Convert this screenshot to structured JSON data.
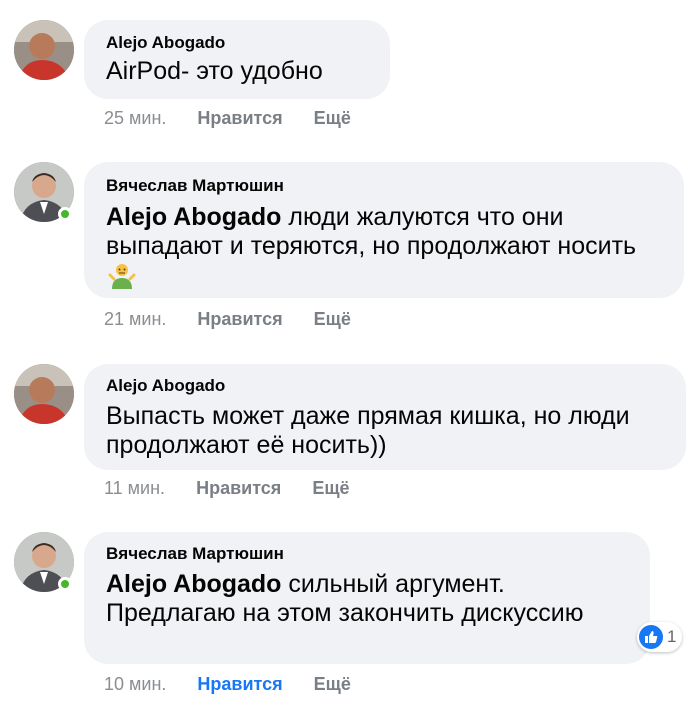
{
  "comments": [
    {
      "author": "Alejo Abogado",
      "mention": "",
      "text": "AirPod- это удобно",
      "time": "25 мин.",
      "like_label": "Нравится",
      "more_label": "Ещё"
    },
    {
      "author": "Вячеслав Мартюшин",
      "mention": "Alejo Abogado",
      "text": "люди жалуются что они выпадают и теряются, но продолжают носить",
      "emoji": "person-shrugging-emoji",
      "time": "21 мин.",
      "like_label": "Нравится",
      "more_label": "Ещё"
    },
    {
      "author": "Alejo Abogado",
      "mention": "",
      "text": "Выпасть может даже прямая кишка, но люди продолжают её носить))",
      "time": "11 мин.",
      "like_label": "Нравится",
      "more_label": "Ещё"
    },
    {
      "author": "Вячеслав Мартюшин",
      "mention": "Alejo Abogado",
      "text": "сильный аргумент. Предлагаю на этом закончить дискуссию",
      "time": "10 мин.",
      "like_label": "Нравится",
      "more_label": "Ещё",
      "reaction_count": "1"
    }
  ],
  "colors": {
    "bubble": "#f0f2f5",
    "liked": "#1877f2",
    "online": "#42b72a",
    "meta": "#7a7f86"
  }
}
